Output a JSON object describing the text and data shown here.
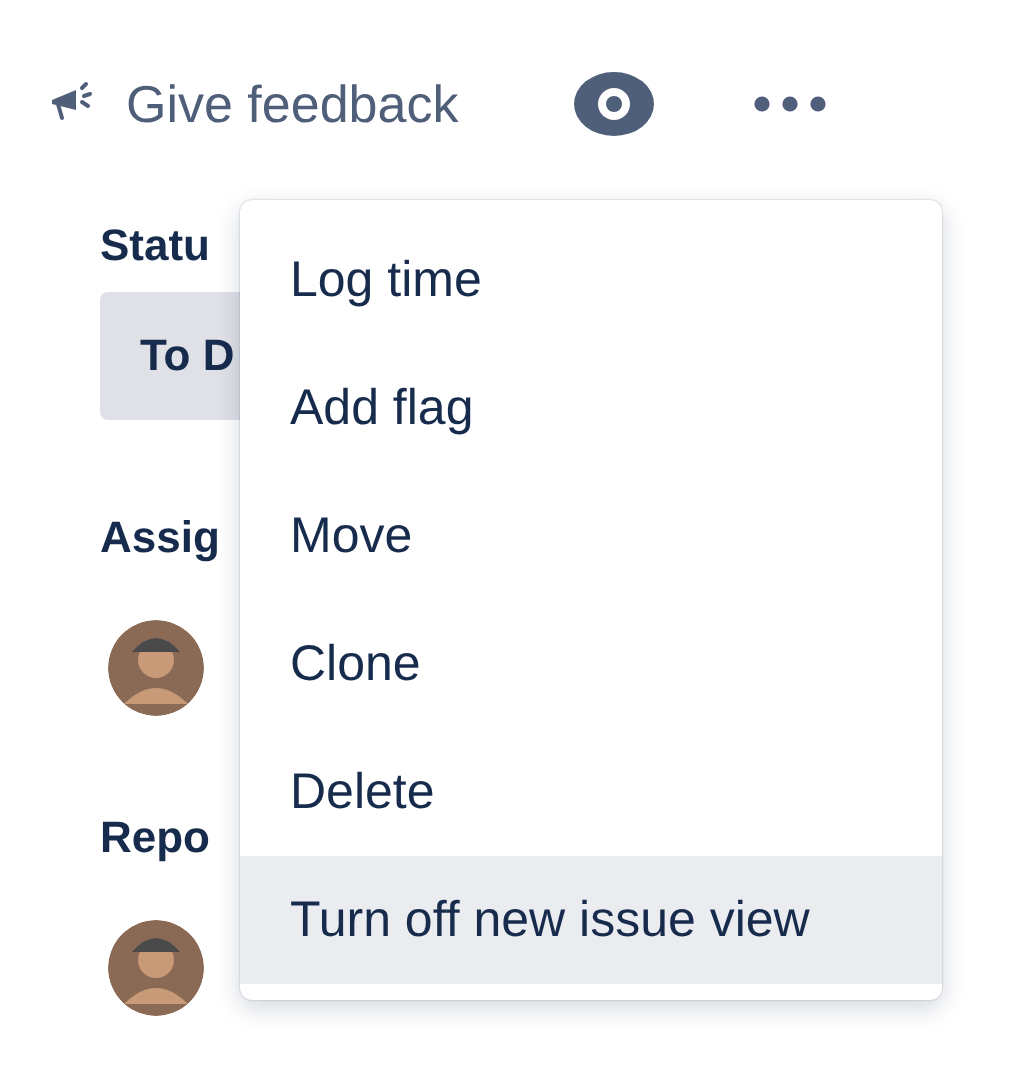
{
  "toolbar": {
    "feedback_label": "Give feedback"
  },
  "fields": [
    {
      "label": "Statu",
      "kind": "status",
      "value": "To D"
    },
    {
      "label": "Assig",
      "kind": "person"
    },
    {
      "label": "Repo",
      "kind": "person"
    }
  ],
  "menu": {
    "items": [
      {
        "label": "Log time",
        "selected": false
      },
      {
        "label": "Add flag",
        "selected": false
      },
      {
        "label": "Move",
        "selected": false
      },
      {
        "label": "Clone",
        "selected": false
      },
      {
        "label": "Delete",
        "selected": false
      },
      {
        "label": "Turn off new issue view",
        "selected": true
      }
    ]
  }
}
